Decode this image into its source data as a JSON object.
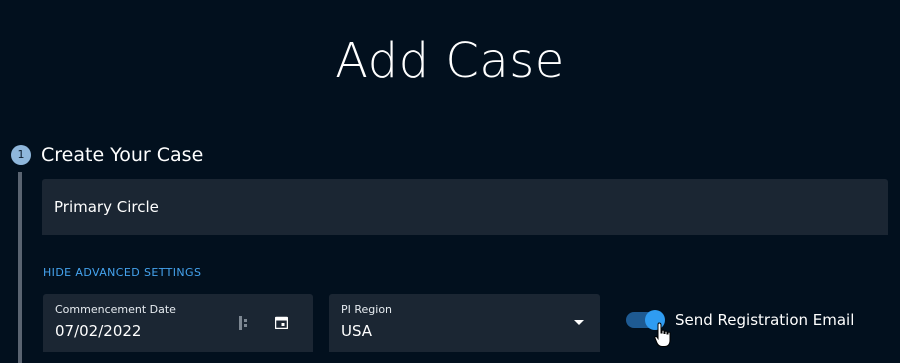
{
  "page": {
    "title": "Add Case"
  },
  "step": {
    "number": "1",
    "title": "Create Your Case"
  },
  "case_name": {
    "value": "Primary Circle"
  },
  "advanced": {
    "link_label": "HIDE ADVANCED SETTINGS"
  },
  "commencement_date": {
    "label": "Commencement Date",
    "value": "07/02/2022",
    "icons": [
      "spin-icon",
      "calendar-icon"
    ]
  },
  "pi_region": {
    "label": "PI Region",
    "value": "USA",
    "icon": "chevron-down-icon"
  },
  "registration_email": {
    "label": "Send Registration Email",
    "checked": true
  },
  "colors": {
    "background": "#02101e",
    "field_background": "#1b2633",
    "accent": "#2f9cf2",
    "link": "#45a3ee",
    "step_badge": "#8fb7dc"
  }
}
